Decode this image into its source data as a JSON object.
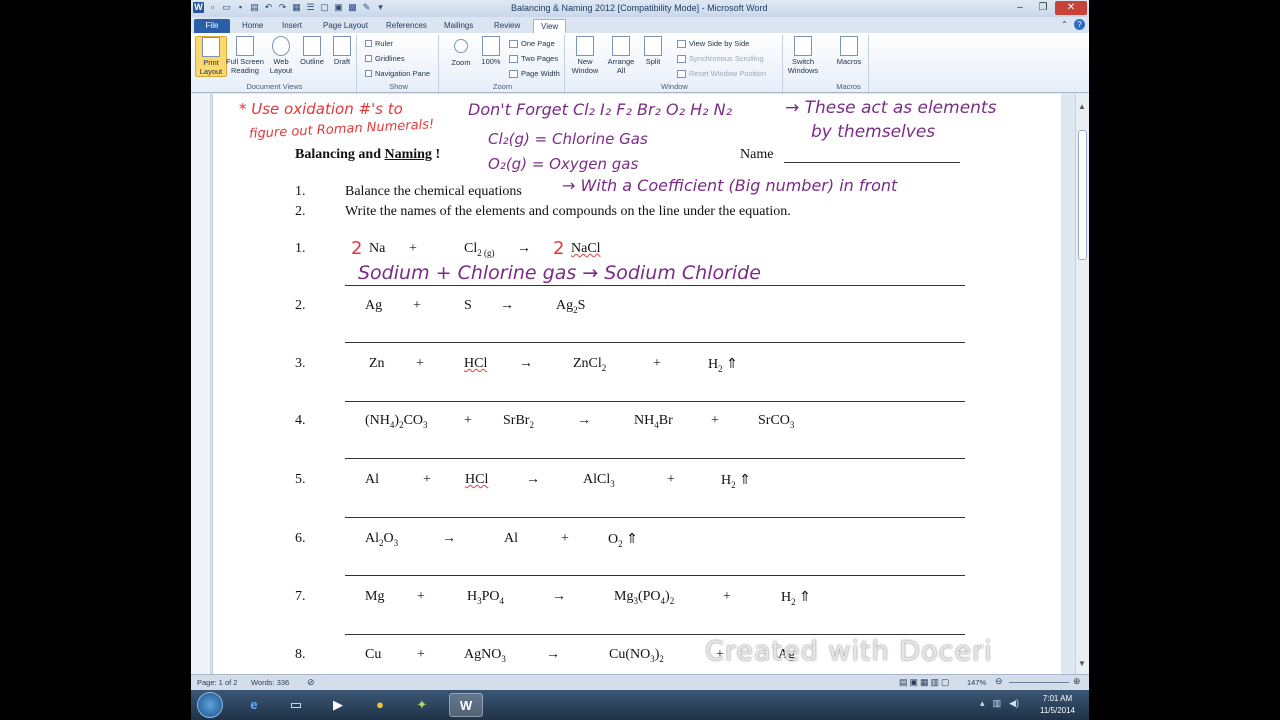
{
  "window": {
    "title": "Balancing & Naming 2012 [Compatibility Mode] - Microsoft Word"
  },
  "tabs": [
    "Home",
    "Insert",
    "Page Layout",
    "References",
    "Mailings",
    "Review",
    "View"
  ],
  "file_tab": "File",
  "active_tab": "View",
  "ribbon": {
    "document_views": {
      "label": "Document Views",
      "print_layout": "Print Layout",
      "full_screen_reading": "Full Screen Reading",
      "web_layout": "Web Layout",
      "outline": "Outline",
      "draft": "Draft"
    },
    "show": {
      "label": "Show",
      "ruler": "Ruler",
      "gridlines": "Gridlines",
      "navigation_pane": "Navigation Pane"
    },
    "zoom": {
      "label": "Zoom",
      "zoom": "Zoom",
      "percent": "100%",
      "one_page": "One Page",
      "two_pages": "Two Pages",
      "page_width": "Page Width"
    },
    "window": {
      "label": "Window",
      "new_window": "New Window",
      "arrange_all": "Arrange All",
      "split": "Split",
      "view_side_by_side": "View Side by Side",
      "synchronous_scrolling": "Synchronous Scrolling",
      "reset_window_position": "Reset Window Position",
      "switch_windows": "Switch Windows"
    },
    "macros": {
      "label": "Macros",
      "macros": "Macros"
    }
  },
  "document": {
    "title": "Balancing and Naming !",
    "title_underlined": "Naming",
    "name_label": "Name",
    "instructions": [
      {
        "num": "1.",
        "text": "Balance the chemical equations"
      },
      {
        "num": "2.",
        "text": "Write the names of the elements and compounds on the line under the equation."
      }
    ],
    "equations": [
      {
        "num": "1.",
        "coef1": "2",
        "a": "Na",
        "p1": "+",
        "b": "Cl",
        "b_sub": "2 (g)",
        "arrow": "→",
        "coef2": "2",
        "c": "NaCl"
      },
      {
        "num": "2.",
        "a": "Ag",
        "p1": "+",
        "b": "S",
        "arrow": "→",
        "c": "Ag",
        "c_sub": "2",
        "c_tail": "S"
      },
      {
        "num": "3.",
        "a": "Zn",
        "p1": "+",
        "b": "HCl",
        "arrow": "→",
        "c": "ZnCl",
        "c_sub": "2",
        "p2": "+",
        "d": "H",
        "d_sub": "2",
        "d_tail": " ⇑"
      },
      {
        "num": "4.",
        "a": "(NH",
        "a_sub": "4",
        "a_tail": ")",
        "a_sub2": "2",
        "a_tail2": "CO",
        "a_sub3": "3",
        "p1": "+",
        "b": "SrBr",
        "b_sub": "2",
        "arrow": "→",
        "c": "NH",
        "c_sub": "4",
        "c_tail": "Br",
        "p2": "+",
        "d": "SrCO",
        "d_sub": "3"
      },
      {
        "num": "5.",
        "a": "Al",
        "p1": "+",
        "b": "HCl",
        "arrow": "→",
        "c": "AlCl",
        "c_sub": "3",
        "p2": "+",
        "d": "H",
        "d_sub": "2",
        "d_tail": " ⇑"
      },
      {
        "num": "6.",
        "a": "Al",
        "a_sub": "2",
        "a_tail": "O",
        "a_sub2": "3",
        "arrow": "→",
        "b": "Al",
        "p1": "+",
        "c": "O",
        "c_sub": "2",
        "c_tail": " ⇑"
      },
      {
        "num": "7.",
        "a": "Mg",
        "p1": "+",
        "b": "H",
        "b_sub": "3",
        "b_tail": "PO",
        "b_sub2": "4",
        "arrow": "→",
        "c": "Mg",
        "c_sub": "3",
        "c_tail": "(PO",
        "c_sub2": "4",
        "c_tail2": ")",
        "c_sub3": "2",
        "p2": "+",
        "d": "H",
        "d_sub": "2",
        "d_tail": " ⇑"
      },
      {
        "num": "8.",
        "a": "Cu",
        "p1": "+",
        "b": "AgNO",
        "b_sub": "3",
        "arrow": "→",
        "c": "Cu(NO",
        "c_sub": "3",
        "c_tail": ")",
        "c_sub2": "2",
        "p2": "+",
        "d": "Ag"
      }
    ]
  },
  "annotations": {
    "red_note_1": "* Use oxidation #'s to",
    "red_note_2": "figure out Roman Numerals!",
    "dont_forget": "Don't Forget Cl₂ I₂ F₂  Br₂ O₂ H₂ N₂",
    "these_act_1": "→ These act as elements",
    "these_act_2": "by themselves",
    "chlorine": "Cl₂(g) = Chlorine Gas",
    "oxygen": "O₂(g) = Oxygen gas",
    "coefficient": "→ With a Coefficient (Big number) in front",
    "answer_1": "Sodium + Chlorine gas → Sodium Chloride"
  },
  "status_bar": {
    "page": "Page: 1 of 2",
    "words": "Words: 336",
    "zoom": "147%"
  },
  "watermark": "Created with Doceri",
  "taskbar": {
    "time": "7:01 AM",
    "date": "11/5/2014"
  }
}
